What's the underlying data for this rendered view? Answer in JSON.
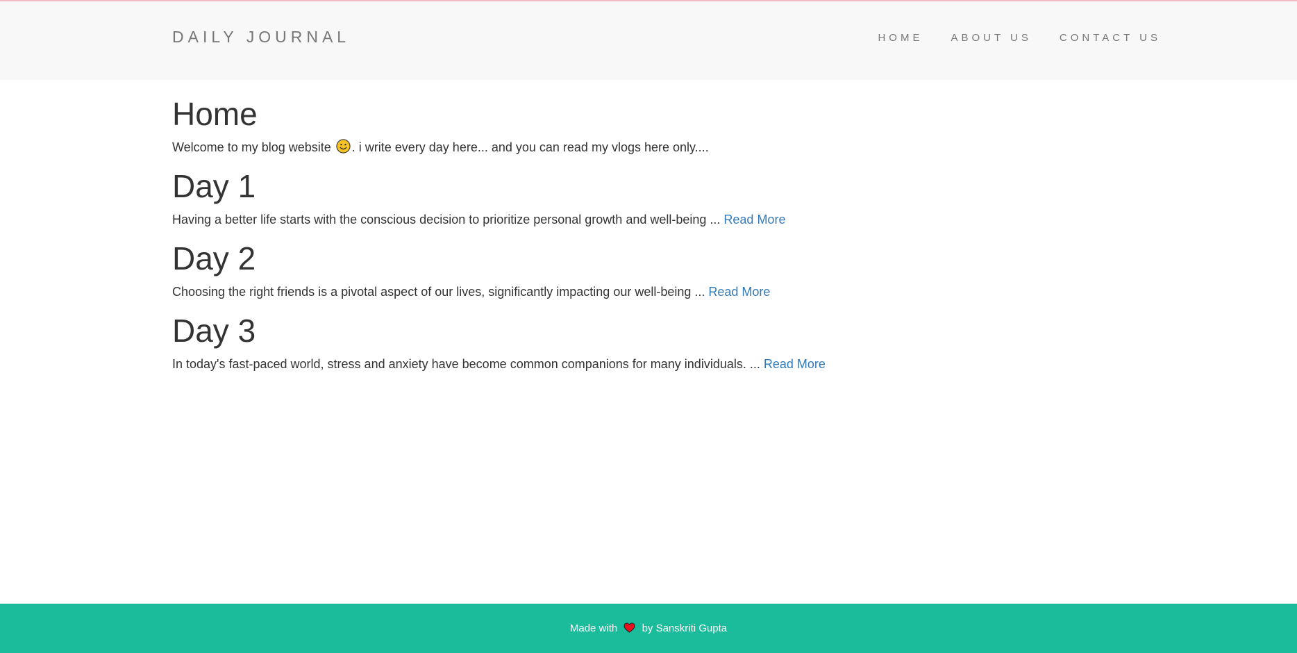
{
  "header": {
    "brand": "DAILY JOURNAL",
    "nav": [
      {
        "label": "HOME"
      },
      {
        "label": "ABOUT US"
      },
      {
        "label": "CONTACT US"
      }
    ]
  },
  "home": {
    "heading": "Home",
    "intro_before": "Welcome to my blog website ",
    "intro_icon": "smiley-face-icon",
    "intro_after": ". i write every day here... and you can read my vlogs here only...."
  },
  "posts": [
    {
      "title": "Day 1",
      "excerpt": "Having a better life starts with the conscious decision to prioritize personal growth and well-being ... ",
      "link": "Read More"
    },
    {
      "title": "Day 2",
      "excerpt": "Choosing the right friends is a pivotal aspect of our lives, significantly impacting our well-being ... ",
      "link": "Read More"
    },
    {
      "title": "Day 3",
      "excerpt": "In today's fast-paced world, stress and anxiety have become common companions for many individuals. ... ",
      "link": "Read More"
    }
  ],
  "footer": {
    "before": "Made with ",
    "icon": "heart-icon",
    "after": " by Sanskriti Gupta"
  },
  "colors": {
    "navbar_bg": "#f8f8f8",
    "footer_bg": "#1abc9c",
    "link": "#337ab7",
    "text": "#333333",
    "nav_text": "#777777"
  }
}
